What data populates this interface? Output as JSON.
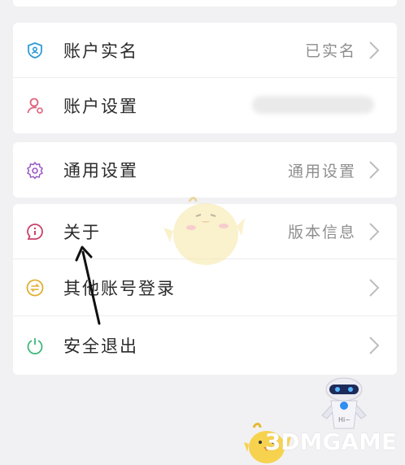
{
  "menu": {
    "group1": [
      {
        "label": "账户实名",
        "value": "已实名",
        "icon": "shield-user-icon"
      },
      {
        "label": "账户设置",
        "value": "",
        "icon": "user-settings-icon"
      }
    ],
    "group2": [
      {
        "label": "通用设置",
        "value": "通用设置",
        "icon": "gear-icon"
      }
    ],
    "group3": [
      {
        "label": "关于",
        "value": "版本信息",
        "icon": "info-icon"
      },
      {
        "label": "其他账号登录",
        "value": "",
        "icon": "switch-account-icon"
      },
      {
        "label": "安全退出",
        "value": "",
        "icon": "power-icon"
      }
    ]
  },
  "robot_badge": "Hi~",
  "watermark": "3DMGAME",
  "colors": {
    "shield": "#2f9bd8",
    "user": "#e0627c",
    "gear": "#9b59c4",
    "info": "#c9426b",
    "switch": "#e0b030",
    "power": "#3cb878"
  }
}
